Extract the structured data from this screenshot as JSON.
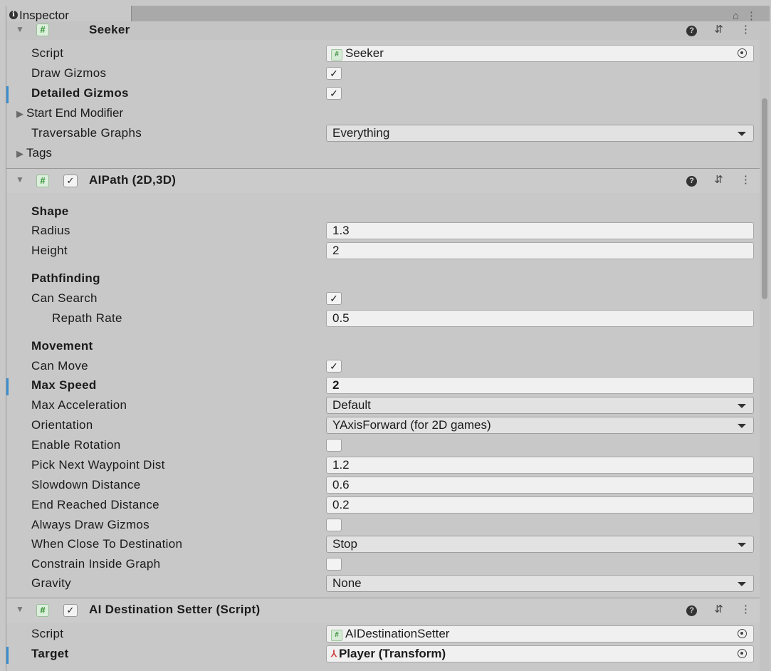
{
  "window": {
    "tab_title": "Inspector"
  },
  "seeker": {
    "title": "Seeker",
    "script_label": "Script",
    "script_value": "Seeker",
    "draw_gizmos_label": "Draw Gizmos",
    "draw_gizmos": true,
    "detailed_gizmos_label": "Detailed Gizmos",
    "detailed_gizmos": true,
    "start_end_modifier_label": "Start End Modifier",
    "traversable_graphs_label": "Traversable Graphs",
    "traversable_graphs_value": "Everything",
    "tags_label": "Tags"
  },
  "aipath": {
    "title": "AIPath (2D,3D)",
    "enabled": true,
    "shape_header": "Shape",
    "radius_label": "Radius",
    "radius_value": "1.3",
    "height_label": "Height",
    "height_value": "2",
    "pathfinding_header": "Pathfinding",
    "can_search_label": "Can Search",
    "can_search": true,
    "repath_rate_label": "Repath Rate",
    "repath_rate_value": "0.5",
    "movement_header": "Movement",
    "can_move_label": "Can Move",
    "can_move": true,
    "max_speed_label": "Max Speed",
    "max_speed_value": "2",
    "max_accel_label": "Max Acceleration",
    "max_accel_value": "Default",
    "orientation_label": "Orientation",
    "orientation_value": "YAxisForward (for 2D games)",
    "enable_rotation_label": "Enable Rotation",
    "enable_rotation": false,
    "pick_next_label": "Pick Next Waypoint Dist",
    "pick_next_value": "1.2",
    "slowdown_label": "Slowdown Distance",
    "slowdown_value": "0.6",
    "end_reached_label": "End Reached Distance",
    "end_reached_value": "0.2",
    "always_draw_label": "Always Draw Gizmos",
    "always_draw": false,
    "when_close_label": "When Close To Destination",
    "when_close_value": "Stop",
    "constrain_label": "Constrain Inside Graph",
    "constrain": false,
    "gravity_label": "Gravity",
    "gravity_value": "None"
  },
  "destsetter": {
    "title": "AI Destination Setter (Script)",
    "enabled": true,
    "script_label": "Script",
    "script_value": "AIDestinationSetter",
    "target_label": "Target",
    "target_value": "Player (Transform)"
  },
  "icons": {
    "check_glyph": "✓",
    "script_glyph": "#",
    "help_glyph": "?",
    "settings_glyph": "⇵",
    "menu_glyph": "⋮",
    "lock_glyph": "🔒︎"
  },
  "colors": {
    "script_icon_green": "#3a8a3a",
    "modified_bar_blue": "#3a8fd0",
    "panel_bg": "#c8c8c8"
  }
}
